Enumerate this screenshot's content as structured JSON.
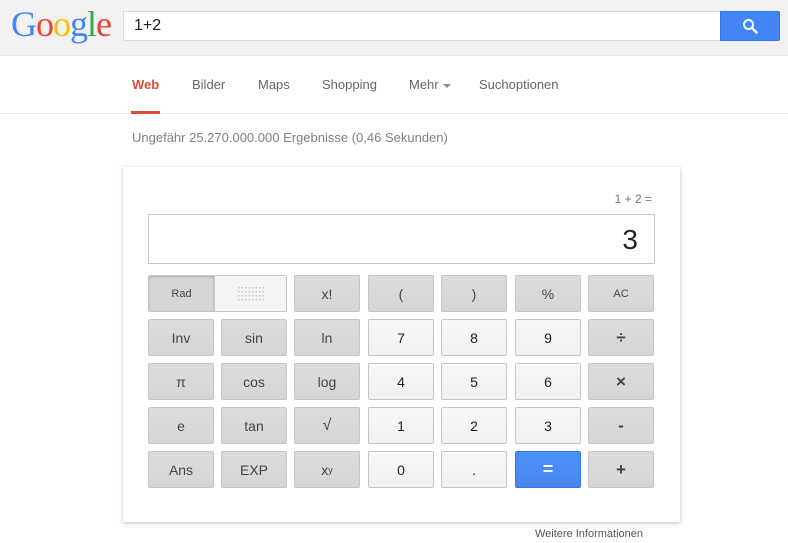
{
  "search": {
    "query": "1+2"
  },
  "nav": {
    "items": [
      {
        "label": "Web",
        "active": true
      },
      {
        "label": "Bilder"
      },
      {
        "label": "Maps"
      },
      {
        "label": "Shopping"
      },
      {
        "label": "Mehr"
      },
      {
        "label": "Suchoptionen"
      }
    ]
  },
  "results": {
    "info": "Ungefähr 25.270.000.000 Ergebnisse (0,46 Sekunden)"
  },
  "calculator": {
    "expression": "1 + 2 =",
    "display": "3",
    "mode_label": "Rad",
    "keys": {
      "fact": "x!",
      "lparen": "(",
      "rparen": ")",
      "percent": "%",
      "ac": "AC",
      "inv": "Inv",
      "sin": "sin",
      "ln": "ln",
      "k7": "7",
      "k8": "8",
      "k9": "9",
      "divide": "÷",
      "pi": "π",
      "cos": "cos",
      "log": "log",
      "k4": "4",
      "k5": "5",
      "k6": "6",
      "multiply": "×",
      "e": "e",
      "tan": "tan",
      "sqrt": "√",
      "k1": "1",
      "k2": "2",
      "k3": "3",
      "minus": "-",
      "ans": "Ans",
      "exp": "EXP",
      "k0": "0",
      "dot": ".",
      "equals": "=",
      "plus": "+"
    },
    "power_base": "x",
    "power_exp": "y"
  },
  "footer": {
    "more_info": "Weitere Informationen"
  },
  "colors": {
    "accent_red": "#dd4b39",
    "search_blue": "#4285f4"
  }
}
